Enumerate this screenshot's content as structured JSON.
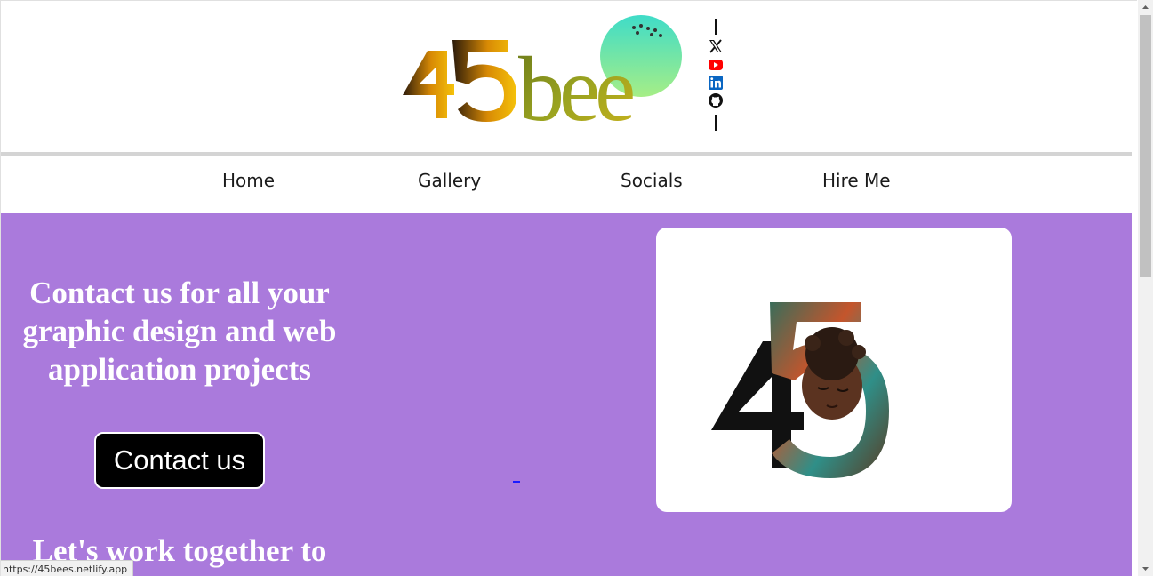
{
  "header": {
    "logo_text": "45bee",
    "socials": [
      "x-icon",
      "youtube-icon",
      "linkedin-icon",
      "github-icon"
    ]
  },
  "nav": {
    "items": [
      {
        "label": "Home"
      },
      {
        "label": "Gallery"
      },
      {
        "label": "Socials"
      },
      {
        "label": "Hire Me"
      }
    ]
  },
  "hero": {
    "heading": "Contact us for all your graphic design and web application projects",
    "cta_label": "Contact us",
    "subheading": "Let's work together to",
    "card_logo_text": "45"
  },
  "status_bar": {
    "url": "https://45bees.netlify.app"
  },
  "colors": {
    "hero_bg": "#aa7adc",
    "button_bg": "#000000",
    "youtube": "#ff0000",
    "linkedin": "#0a66c2"
  }
}
